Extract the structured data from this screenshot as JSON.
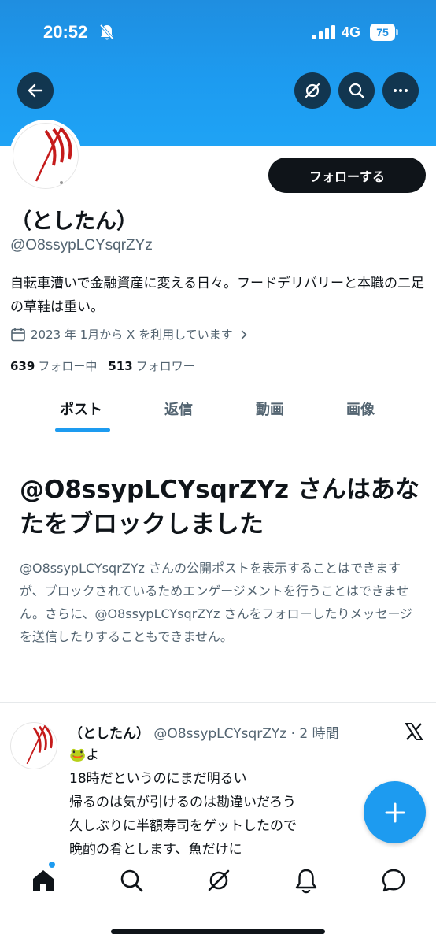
{
  "status_bar": {
    "time": "20:52",
    "network": "4G",
    "battery": "75"
  },
  "header": {
    "back_icon": "arrow-left-icon",
    "grok_icon": "grok-icon",
    "search_icon": "search-icon",
    "more_icon": "more-horizontal-icon",
    "banner_color": "#1d9bf0"
  },
  "profile": {
    "follow_label": "フォローする",
    "display_name": "（としたん）",
    "handle": "@O8ssypLCYsqrZYz",
    "bio": "自転車漕いで金融資産に変える日々。フードデリバリーと本職の二足の草鞋は重い。",
    "joined": "2023 年 1月から X を利用しています",
    "following_count": "639",
    "following_label": "フォロー中",
    "followers_count": "513",
    "followers_label": "フォロワー"
  },
  "tabs": [
    {
      "label": "ポスト",
      "active": true
    },
    {
      "label": "返信",
      "active": false
    },
    {
      "label": "動画",
      "active": false
    },
    {
      "label": "画像",
      "active": false
    }
  ],
  "blocked": {
    "title": "@O8ssypLCYsqrZYz さんはあなたをブロックしました",
    "description": "@O8ssypLCYsqrZYz さんの公開ポストを表示することはできますが、ブロックされているためエンゲージメントを行うことはできません。さらに、@O8ssypLCYsqrZYz さんをフォローしたりメッセージを送信したりすることもできません。"
  },
  "post": {
    "name": "（としたん）",
    "meta": "@O8ssypLCYsqrZYz · 2 時間",
    "lines": [
      "🐸よ",
      "18時だというのにまだ明るい",
      "帰るのは気が引けるのは勘違いだろう",
      "久しぶりに半額寿司をゲットしたので",
      "晩酌の肴とします、魚だけに"
    ]
  },
  "bottom_nav": [
    {
      "icon": "home-icon",
      "active": true
    },
    {
      "icon": "search-icon",
      "active": false
    },
    {
      "icon": "grok-icon",
      "active": false
    },
    {
      "icon": "bell-icon",
      "active": false
    },
    {
      "icon": "messages-icon",
      "active": false
    }
  ],
  "colors": {
    "accent": "#1d9bf0",
    "text_primary": "#0f1419",
    "text_secondary": "#536471"
  }
}
